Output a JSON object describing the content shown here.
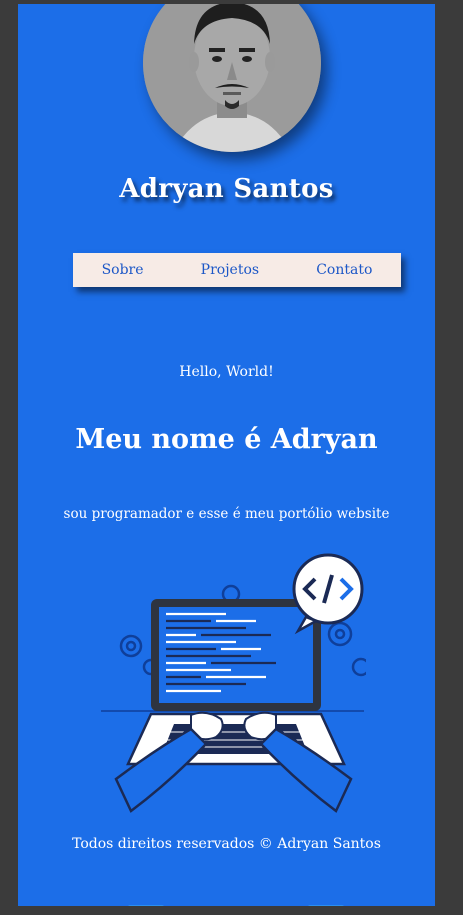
{
  "profile": {
    "name": "Adryan Santos"
  },
  "nav": {
    "items": [
      "Sobre",
      "Projetos",
      "Contato"
    ]
  },
  "hero": {
    "greeting": "Hello, World!",
    "headline": "Meu nome é Adryan",
    "subtitle": "sou programador e esse é meu portólio website",
    "code_icon": "</>"
  },
  "footer": {
    "text": "Todos direitos reservados © Adryan Santos"
  },
  "colors": {
    "page_background": "#1c6ee8",
    "nav_background": "#f7ebe6",
    "nav_text": "#1c57c7",
    "frame": "#3b3b3b"
  },
  "icons": [
    "avatar-photo",
    "code-bubble-icon",
    "gear-icon",
    "laptop-illustration"
  ]
}
